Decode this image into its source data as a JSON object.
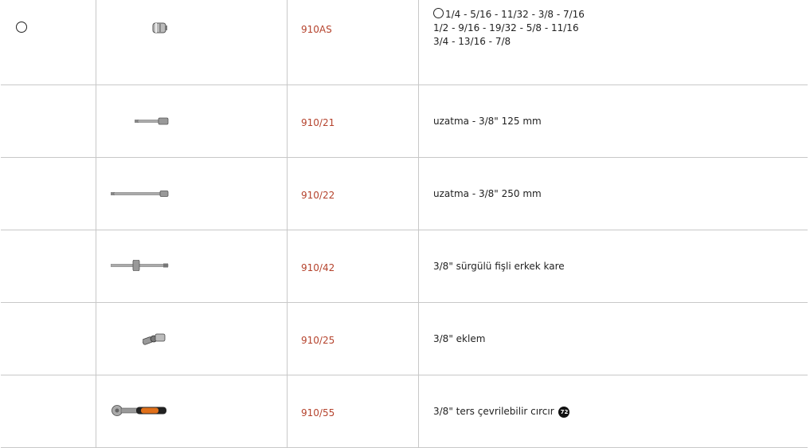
{
  "rows": [
    {
      "code": "910AS",
      "desc_lines": [
        "1/4 - 5/16 - 11/32 - 3/8 - 7/16",
        "1/2 - 9/16 - 19/32 - 5/8 - 11/16",
        "3/4 - 13/16 - 7/8"
      ],
      "tool_icon": "socket-icon",
      "marker_icon": "circle-icon"
    },
    {
      "code": "910/21",
      "desc": "uzatma - 3/8\" 125 mm",
      "tool_icon": "short-extension-bar-icon"
    },
    {
      "code": "910/22",
      "desc": "uzatma - 3/8\" 250 mm",
      "tool_icon": "long-extension-bar-icon"
    },
    {
      "code": "910/42",
      "desc": "3/8\" sürgülü fişli erkek kare",
      "tool_icon": "sliding-t-handle-icon"
    },
    {
      "code": "910/25",
      "desc": "3/8\" eklem",
      "tool_icon": "universal-joint-icon"
    },
    {
      "code": "910/55",
      "desc": "3/8\" ters çevrilebilir cırcır",
      "tool_icon": "ratchet-icon",
      "badge_icon": "72-teeth-badge-icon",
      "badge_text": "72"
    }
  ],
  "colors": {
    "code": "#b5432d",
    "border": "#c8c8c8",
    "ratchet_grip": "#e0701a"
  }
}
